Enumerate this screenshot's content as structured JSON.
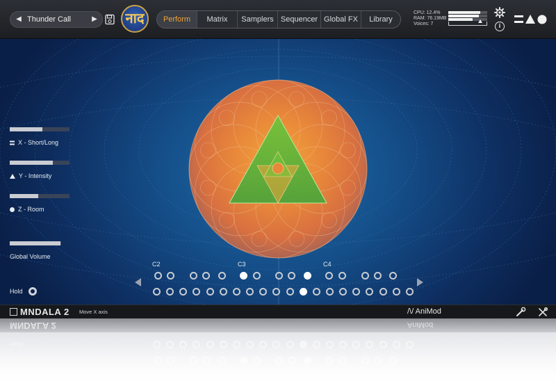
{
  "preset": {
    "name": "Thunder Call"
  },
  "logo_text": "नाद",
  "tabs": [
    {
      "label": "Perform",
      "active": true
    },
    {
      "label": "Matrix",
      "active": false
    },
    {
      "label": "Samplers",
      "active": false
    },
    {
      "label": "Sequencer",
      "active": false
    },
    {
      "label": "Global FX",
      "active": false
    },
    {
      "label": "Library",
      "active": false
    }
  ],
  "stats": {
    "cpu": "CPU: 12.4%",
    "ram": "RAM: 76.19MB",
    "voices": "Voices: 7"
  },
  "meters": [
    0.82,
    0.78,
    0.62
  ],
  "meter_marker": 0.82,
  "axes": [
    {
      "label": "X - Short/Long",
      "icon": "equals-icon",
      "value": 0.55
    },
    {
      "label": "Y - Intensity",
      "icon": "triangle-icon",
      "value": 0.72
    },
    {
      "label": "Z - Room",
      "icon": "circle-icon",
      "value": 0.48
    }
  ],
  "global_volume": {
    "label": "Global Volume",
    "value": 0.98
  },
  "hold": {
    "label": "Hold",
    "on": false
  },
  "keyboard": {
    "octave_labels": [
      "C2",
      "C3",
      "C4"
    ],
    "upper_on": [
      5,
      9
    ],
    "lower_on": [
      11
    ]
  },
  "footer": {
    "logo": "MNDALA 2",
    "hint": "Move X axis",
    "animod": "AniMod"
  },
  "colors": {
    "accent": "#f0a43a",
    "background": "#154f8a",
    "orb_outer": "#e2783a",
    "triangle": "#6cc23a"
  }
}
